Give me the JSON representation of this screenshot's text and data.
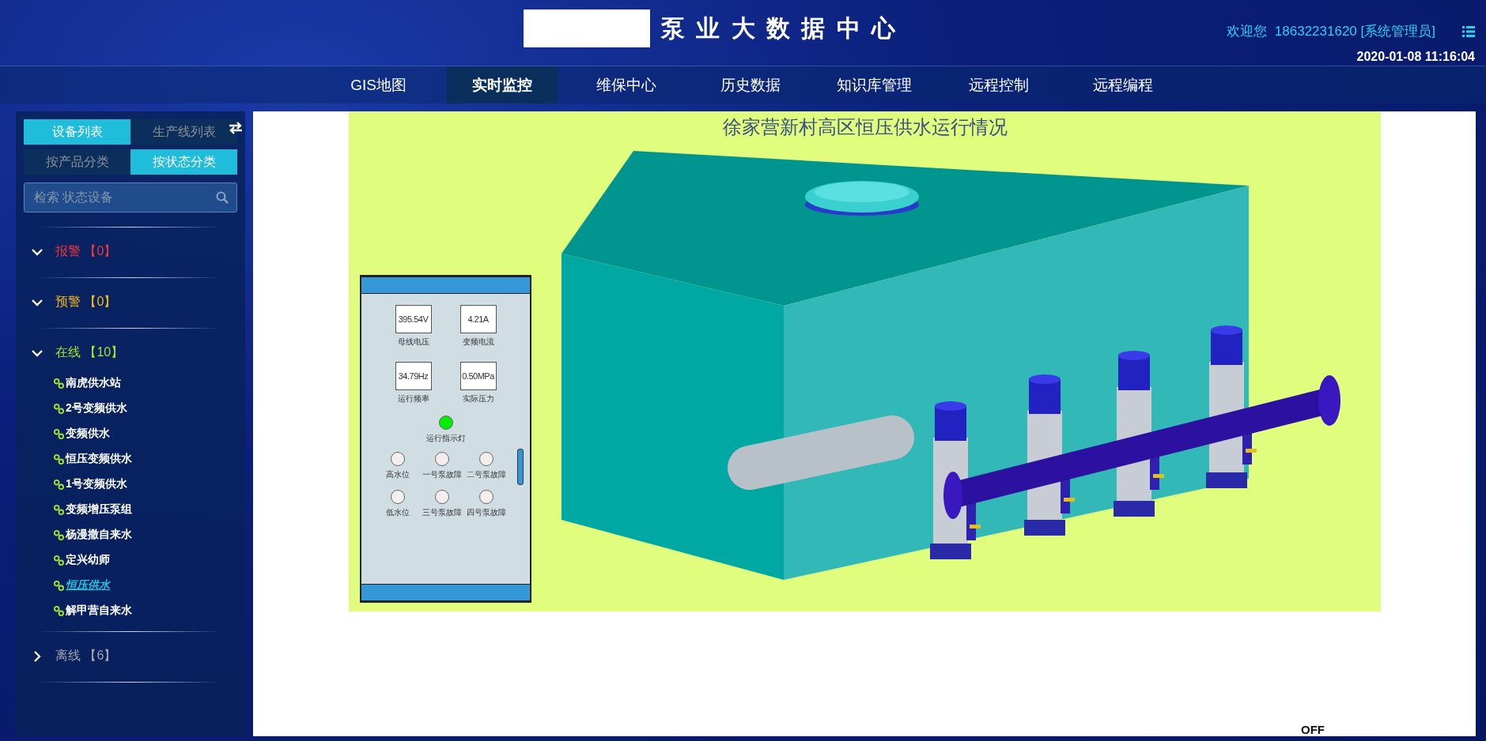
{
  "header": {
    "title": "泵 业 大 数 据 中 心",
    "welcome": "欢迎您",
    "user": "18632231620 [系统管理员]",
    "datetime": "2020-01-08 11:16:04"
  },
  "nav": [
    {
      "label": "GIS地图",
      "selected": false
    },
    {
      "label": "实时监控",
      "selected": true
    },
    {
      "label": "维保中心",
      "selected": false
    },
    {
      "label": "历史数据",
      "selected": false
    },
    {
      "label": "知识库管理",
      "selected": false
    },
    {
      "label": "远程控制",
      "selected": false
    },
    {
      "label": "远程编程",
      "selected": false
    }
  ],
  "sidebar": {
    "list_tabs": [
      {
        "label": "设备列表",
        "selected": true
      },
      {
        "label": "生产线列表",
        "selected": false
      }
    ],
    "filter_tabs": [
      {
        "label": "按产品分类",
        "selected": false
      },
      {
        "label": "按状态分类",
        "selected": true
      }
    ],
    "search": {
      "placeholder": "检索 状态设备"
    },
    "groups": [
      {
        "label": "报警 【0】",
        "color": "#f0353b",
        "expanded": true
      },
      {
        "label": "预警 【0】",
        "color": "#f3b814",
        "expanded": true
      },
      {
        "label": "在线 【10】",
        "color": "#a6e22e",
        "expanded": true,
        "children": [
          {
            "label": "南虎供水站",
            "selected": false
          },
          {
            "label": "2号变频供水",
            "selected": false
          },
          {
            "label": "变频供水",
            "selected": false
          },
          {
            "label": "恒压变频供水",
            "selected": false
          },
          {
            "label": "1号变频供水",
            "selected": false
          },
          {
            "label": "变频增压泵组",
            "selected": false
          },
          {
            "label": "杨漫撒自来水",
            "selected": false
          },
          {
            "label": "定兴幼师",
            "selected": false
          },
          {
            "label": "恒压供水",
            "selected": true
          },
          {
            "label": "解甲营自来水",
            "selected": false
          }
        ]
      },
      {
        "label": "离线 【6】",
        "color": "#a0a4ac",
        "expanded": false
      }
    ]
  },
  "scene": {
    "title": "徐家营新村高区恒压供水运行情况",
    "gauges": [
      {
        "value": "395.54V",
        "label": "母线电压"
      },
      {
        "value": "4.21A",
        "label": "变频电流"
      },
      {
        "value": "34.79Hz",
        "label": "运行频率"
      },
      {
        "value": "0.50MPa",
        "label": "实际压力"
      }
    ],
    "run_light": {
      "label": "运行指示灯",
      "on": true
    },
    "indicators": [
      {
        "label": "高水位",
        "on": false
      },
      {
        "label": "一号泵故障",
        "on": false
      },
      {
        "label": "二号泵故障",
        "on": false
      },
      {
        "label": "低水位",
        "on": false
      },
      {
        "label": "三号泵故障",
        "on": false
      },
      {
        "label": "四号泵故障",
        "on": false
      }
    ]
  },
  "status": "OFF"
}
